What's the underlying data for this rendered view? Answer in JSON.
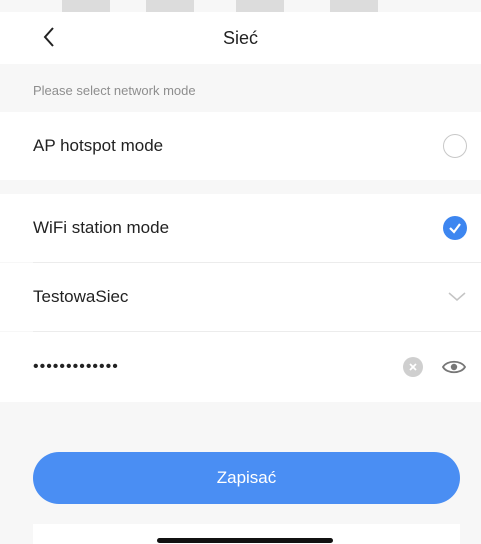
{
  "header": {
    "title": "Sieć"
  },
  "section": {
    "label": "Please select network mode"
  },
  "modes": [
    {
      "label": "AP hotspot mode",
      "selected": false
    },
    {
      "label": "WiFi station mode",
      "selected": true
    }
  ],
  "network": {
    "ssid": "TestowaSiec",
    "password_masked": "•••••••••••••"
  },
  "actions": {
    "save_label": "Zapisać"
  },
  "colors": {
    "accent": "#3d86f0",
    "button": "#4a8ef3"
  },
  "icons": {
    "back": "back-arrow-icon",
    "check": "check-icon",
    "chevron": "chevron-down-icon",
    "clear": "clear-icon",
    "visibility": "eye-icon"
  }
}
